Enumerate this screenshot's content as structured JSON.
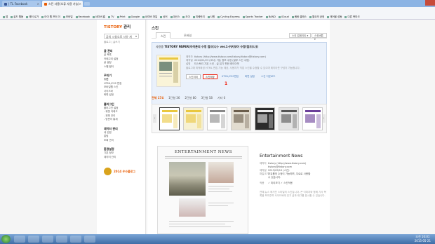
{
  "browser": {
    "tabs": [
      {
        "title": "| TL Facebook",
        "active": false
      },
      {
        "title": "스킨 사용(오류 사용 가능)",
        "active": true
      }
    ],
    "url": "rkdrwldk2623.tistory.com/admin/skin/",
    "bookmarks": [
      "앱",
      "골드 웹돔",
      "레터 로가",
      "아이 웹 프러 이",
      "모바일",
      "Facebook",
      "네이버 홈",
      "TV",
      "Print",
      "Google",
      "네이버 마일",
      "상어",
      "대신스",
      "도이",
      "미쉐린리",
      "사원",
      "Cycling Express",
      "Sports Tracker",
      "BAND",
      "iCloud",
      "쌤탕 클래스",
      "월요의 공정",
      "매어블 성돔",
      "다른 북마크"
    ]
  },
  "sidebar": {
    "logo": "TISTORY",
    "logo_sub": "관리",
    "blog_select": "급의 시청오로 사유 게",
    "blog_sub": "블로그 | 글쓰기",
    "groups": [
      {
        "title": "글 관리",
        "items": [
          "글 목록",
          "카테고리 설정",
          "글 설정",
          "스팸 필터"
        ]
      },
      {
        "title": "꾸미기",
        "items": [
          "스킨",
          "HTML/CSS 편집",
          "모바일웹 스킨",
          "사이드바",
          "화면 설정"
        ]
      },
      {
        "title": "플러그인",
        "items": [
          "플러그인 설정",
          "- 위젯 카테고",
          "- 위젯 관리",
          "- 방문자 통계"
        ]
      },
      {
        "title": "데이터 관리",
        "items": [
          "내 컨텐",
          "알림",
          "조회 관리"
        ]
      },
      {
        "title": "환경설정",
        "items": [
          "기본 정보",
          "데이터 관리"
        ]
      }
    ],
    "active_item": "스킨",
    "badge": "2014 우수블로그"
  },
  "main": {
    "title": "스킨",
    "tabs": [
      "스킨",
      "모바일"
    ],
    "sort_label": "스킨 업데이트 ▾",
    "filter_label": "스킨버튼 ▾",
    "current": {
      "label": "사용중",
      "name": "TISTORY PAPER(아이폰의 수정 접으(나)- ver.1-위키모어 수정(접으(나))",
      "fields": [
        {
          "k": "제작자",
          "v": "tistory (http://www.tistory.com/tistory/tistory@tistory.com)"
        },
        {
          "k": "제작일",
          "v": "2014/01/23 (코너) 기능 정보 수정 (일부 스킨 수정)"
        },
        {
          "k": "설명",
          "v": "티스토리 기본 스킨 - 글 읽기 편한 레이아웃"
        }
      ],
      "description": "블로그에 최적화된 HTML 편집 기능 제공, 사용자가 직접 스킨을 수정할 수 있으며 레이아웃 구성이 가능합니다.",
      "buttons": [
        "스킨저리",
        "스킨저장",
        "HTML/CSS편집",
        "화면 설정",
        "스킨 다운로드"
      ],
      "annotation": "1"
    },
    "filters": [
      {
        "label": "전체 174",
        "active": true
      },
      {
        "label": "1단형 36",
        "active": false
      },
      {
        "label": "2단형 80",
        "active": false
      },
      {
        "label": "3단형 58",
        "active": false
      },
      {
        "label": "기타 0",
        "active": false
      }
    ],
    "thumb_colors": [
      [
        "#fff",
        "#e9c73e"
      ],
      [
        "#f7f1d2",
        "#e9c73e"
      ],
      [
        "#fff",
        "#888"
      ],
      [
        "#e2dccf",
        "#6b5d4b"
      ],
      [
        "#2b2b2b",
        "#f0f0f0"
      ],
      [
        "#e4e4e4",
        "#555"
      ],
      [
        "#fff",
        "#6b3f9a"
      ]
    ],
    "preview": {
      "title": "ENTERTAINMENT NEWS",
      "skin_name": "Entertainment News",
      "fields": [
        {
          "k": "제작자",
          "v": "tistory (http://www.tistory.com)"
        },
        {
          "k": "",
          "v": "tistory@tistory.com"
        },
        {
          "k": "제작일",
          "v": "2013/09/10 (스킨)"
        },
        {
          "k": "파일크기",
          "v": "자유롭게 수정이 가능하며, 무료로 사용할"
        },
        {
          "k": "",
          "v": "수 있습니다."
        },
        {
          "k": "적용",
          "v": "✓ 미리보기   ✓ 스킨적용"
        }
      ],
      "desc": "연예 뉴스 매거진 스타일의 스킨입니다. 큰 이미지와 함께 기사 목록을 보여주며 사이드바에 인기 글과 태그를 표시할 수 있습니다."
    }
  },
  "taskbar": {
    "time": "오전 10:01",
    "date": "2015-05-21"
  }
}
